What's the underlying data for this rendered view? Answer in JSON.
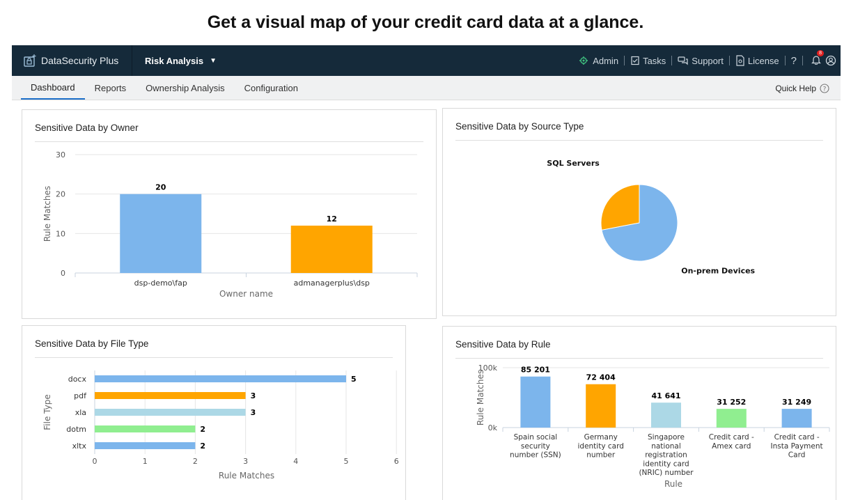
{
  "headline": "Get a visual map of your credit card data at a glance.",
  "app": {
    "brand": "DataSecurity Plus",
    "module": "Risk Analysis",
    "top_links": {
      "admin": "Admin",
      "tasks": "Tasks",
      "support": "Support",
      "license": "License",
      "help": "?",
      "notification_count": "8"
    },
    "tabs": [
      {
        "label": "Dashboard",
        "active": true
      },
      {
        "label": "Reports"
      },
      {
        "label": "Ownership Analysis"
      },
      {
        "label": "Configuration"
      }
    ],
    "quick_help": "Quick Help",
    "colors": {
      "topbar": "#152a3a",
      "accent": "#1c6fc9",
      "blue": "#7cb5ec",
      "orange": "#ffa500",
      "light_blue": "#acd8e6",
      "green": "#90ee90"
    }
  },
  "panels": {
    "owner": {
      "title": "Sensitive Data by Owner"
    },
    "source": {
      "title": "Sensitive Data by Source Type"
    },
    "filetype": {
      "title": "Sensitive Data by File Type"
    },
    "rule": {
      "title": "Sensitive Data by Rule"
    }
  },
  "chart_data": [
    {
      "id": "owner",
      "type": "bar",
      "title": "Sensitive Data by Owner",
      "categories": [
        "dsp-demo\\fap",
        "admanagerplus\\dsp"
      ],
      "values": [
        20,
        12
      ],
      "colors": [
        "#7cb5ec",
        "#ffa500"
      ],
      "xlabel": "Owner name",
      "ylabel": "Rule Matches",
      "ylim": [
        0,
        30
      ],
      "yticks": [
        "0",
        "10",
        "20",
        "30"
      ],
      "grid": true
    },
    {
      "id": "source",
      "type": "pie",
      "title": "Sensitive Data by Source Type",
      "slices": [
        {
          "label": "On-prem Devices",
          "value": 72,
          "color": "#7cb5ec"
        },
        {
          "label": "SQL Servers",
          "value": 28,
          "color": "#ffa500"
        }
      ]
    },
    {
      "id": "filetype",
      "type": "bar",
      "orientation": "horizontal",
      "title": "Sensitive Data by File Type",
      "categories": [
        "docx",
        "pdf",
        "xla",
        "dotm",
        "xltx"
      ],
      "values": [
        5,
        3,
        3,
        2,
        2
      ],
      "colors": [
        "#7cb5ec",
        "#ffa500",
        "#acd8e6",
        "#90ee90",
        "#7cb5ec"
      ],
      "xlabel": "Rule Matches",
      "ylabel": "File Type",
      "xlim": [
        0,
        6
      ],
      "xticks": [
        "0",
        "1",
        "2",
        "3",
        "4",
        "5",
        "6"
      ],
      "grid": true
    },
    {
      "id": "rule",
      "type": "bar",
      "title": "Sensitive Data by Rule",
      "categories": [
        [
          "Spain social",
          "security",
          "number (SSN)"
        ],
        [
          "Germany",
          "identity card",
          "number"
        ],
        [
          "Singapore",
          "national",
          "registration",
          "identity card",
          "(NRIC) number"
        ],
        [
          "Credit card -",
          "Amex card"
        ],
        [
          "Credit card -",
          "Insta Payment",
          "Card"
        ]
      ],
      "values": [
        85201,
        72404,
        41641,
        31252,
        31249
      ],
      "value_labels": [
        "85 201",
        "72 404",
        "41 641",
        "31 252",
        "31 249"
      ],
      "colors": [
        "#7cb5ec",
        "#ffa500",
        "#acd8e6",
        "#90ee90",
        "#7cb5ec"
      ],
      "xlabel": "Rule",
      "ylabel": "Rule Matches",
      "ylim": [
        0,
        100000
      ],
      "yticks": [
        "0k",
        "100k"
      ],
      "grid": true
    }
  ]
}
